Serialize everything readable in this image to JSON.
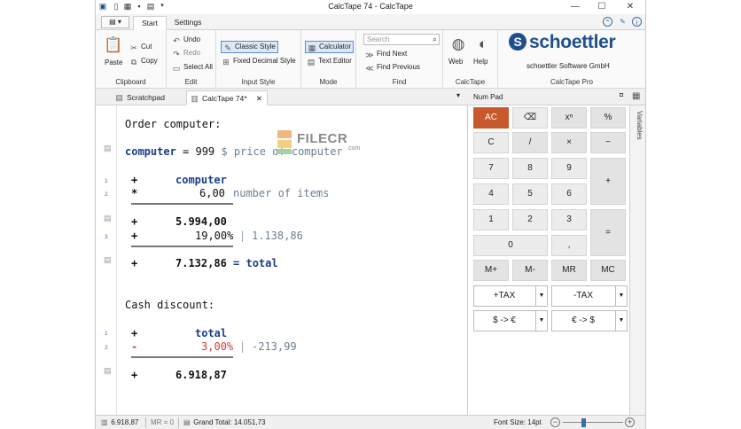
{
  "window": {
    "title": "CalcTape 74 - CalcTape",
    "controls": {
      "minimize": "—",
      "maximize": "☐",
      "close": "✕"
    }
  },
  "quick_access": {
    "icons": [
      "app-icon",
      "new-icon",
      "open-icon",
      "save-icon",
      "print-icon",
      "customize-icon"
    ]
  },
  "ribbon_tabs": {
    "file": "▤ ▾",
    "start": "Start",
    "settings": "Settings"
  },
  "ribbon": {
    "clipboard": {
      "paste": "Paste",
      "cut": "Cut",
      "copy": "Copy",
      "label": "Clipboard"
    },
    "edit": {
      "undo": "Undo",
      "redo": "Redo",
      "select_all": "Select All",
      "label": "Edit"
    },
    "input_style": {
      "classic": "Classic Style",
      "fixed": "Fixed Decimal Style",
      "label": "Input Style"
    },
    "mode": {
      "calculator": "Calculator",
      "text_editor": "Text Editor",
      "label": "Mode"
    },
    "find": {
      "placeholder": "Search",
      "find_next": "Find Next",
      "find_previous": "Find Previous",
      "label": "Find"
    },
    "calctape": {
      "web": "Web",
      "help": "Help",
      "label": "CalcTape"
    },
    "pro": {
      "logo": "schoettler",
      "company": "schoettler Software GmbH",
      "label": "CalcTape Pro"
    }
  },
  "doc_tabs": {
    "scratchpad": "Scratchpad",
    "current": "CalcTape 74*",
    "close": "✕",
    "menu": "▾"
  },
  "watermark": {
    "brand": "FILECR",
    "domain": ".com"
  },
  "tape": {
    "title1": "Order computer:",
    "var_line": {
      "name": "computer",
      "eq": " = 999 ",
      "comment": "$ price of computer"
    },
    "block1": [
      {
        "num": "1",
        "op": "+",
        "value": "computer",
        "comment": ""
      },
      {
        "num": "2",
        "op": "*",
        "value": "6,00",
        "comment": "number of items"
      }
    ],
    "result1": {
      "op": "+",
      "value": "5.994,00"
    },
    "line3": {
      "num": "3",
      "op": "+",
      "value": "19,00%",
      "extra": "1.138,86"
    },
    "total1": {
      "op": "+",
      "value": "7.132,86",
      "assign": " = total"
    },
    "title2": "Cash discount:",
    "block2": [
      {
        "num": "1",
        "op": "+",
        "value": "total",
        "extra": ""
      },
      {
        "num": "2",
        "op": "-",
        "value": "3,00%",
        "extra": "-213,99"
      }
    ],
    "result2": {
      "op": "+",
      "value": "6.918,87"
    }
  },
  "numpad": {
    "title": "Num Pad",
    "pin": "◘",
    "keys": {
      "ac": "AC",
      "backspace": "⌫",
      "pow": "xⁿ",
      "percent": "%",
      "c": "C",
      "div": "/",
      "mul": "×",
      "minus": "−",
      "k7": "7",
      "k8": "8",
      "k9": "9",
      "plus": "+",
      "k4": "4",
      "k5": "5",
      "k6": "6",
      "k1": "1",
      "k2": "2",
      "k3": "3",
      "equals": "=",
      "k0": "0",
      "dot": ",",
      "mplus": "M+",
      "mminus": "M-",
      "mr": "MR",
      "mc": "MC"
    },
    "dropdowns": {
      "plus_tax": "+TAX",
      "minus_tax": "-TAX",
      "usd_eur": "$ -> €",
      "eur_usd": "€ -> $"
    }
  },
  "variables_tab": "Variables",
  "statusbar": {
    "current_value": "6.918,87",
    "memory": "MR = 0",
    "grand_total": "Grand Total: 14.051,73",
    "font_size": "Font Size: 14pt"
  }
}
